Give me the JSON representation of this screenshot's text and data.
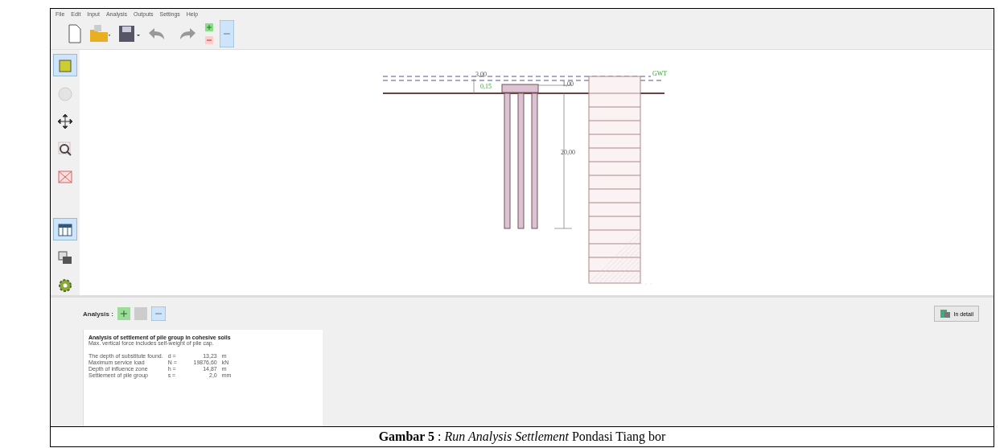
{
  "menu": [
    "File",
    "Edit",
    "Input",
    "Analysis",
    "Outputs",
    "Settings",
    "Help"
  ],
  "drawing": {
    "labels": [
      {
        "kind": "water",
        "text": "3,00"
      },
      {
        "kind": "cap",
        "text": "0,15"
      },
      {
        "kind": "width",
        "text": "1,00"
      },
      {
        "kind": "length",
        "text": "20,00"
      },
      {
        "kind": "gwt",
        "text": "GWT"
      }
    ]
  },
  "analysis": {
    "label": "Analysis :",
    "detail_button": "In detail"
  },
  "results": {
    "title": "Analysis of settlement of pile group in cohesive soils",
    "note": "Max. vertical force includes self-weight of pile cap.",
    "rows": [
      {
        "label": "The depth of substitute found.",
        "symbol": "d =",
        "value": "13,23",
        "unit": "m"
      },
      {
        "label": "Maximum service load",
        "symbol": "N =",
        "value": "19876,60",
        "unit": "kN"
      },
      {
        "label": "Depth of influence zone",
        "symbol": "h =",
        "value": "14,87",
        "unit": "m"
      },
      {
        "label": "Settlement of pile group",
        "symbol": "s =",
        "value": "2,0",
        "unit": "mm"
      }
    ]
  },
  "caption": "**Gambar 5** : *Run Analysis Settlement* Pondasi Tiang bor"
}
